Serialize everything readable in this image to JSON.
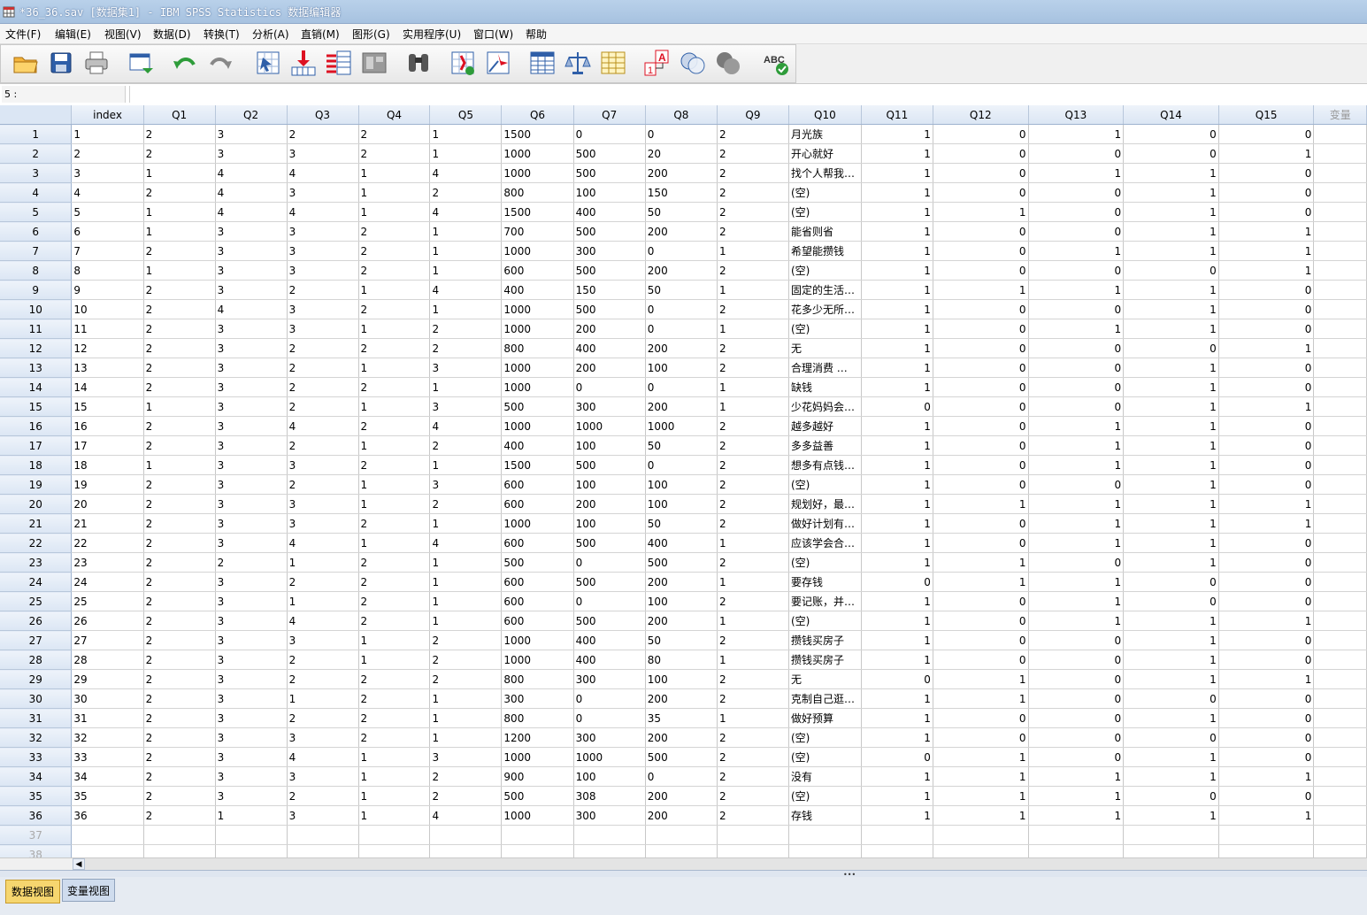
{
  "window": {
    "title": "*36_36.sav [数据集1] - IBM SPSS Statistics 数据编辑器"
  },
  "menu": [
    "文件(F)",
    "编辑(E)",
    "视图(V)",
    "数据(D)",
    "转换(T)",
    "分析(A)",
    "直销(M)",
    "图形(G)",
    "实用程序(U)",
    "窗口(W)",
    "帮助"
  ],
  "toolbar": {
    "icons": [
      "open-folder-icon",
      "save-icon",
      "print-icon",
      "recall-dialog-icon",
      "undo-icon",
      "redo-icon",
      "goto-case-icon",
      "goto-variable-icon",
      "variables-icon",
      "run-descriptives-icon",
      "find-icon",
      "insert-cases-icon",
      "insert-variable-icon",
      "split-file-icon",
      "weight-cases-icon",
      "select-cases-icon",
      "value-labels-icon",
      "use-sets-icon",
      "show-all-variables-icon",
      "spell-check-icon"
    ]
  },
  "cellbar": {
    "ref": "5 :",
    "value": ""
  },
  "columns": [
    "index",
    "Q1",
    "Q2",
    "Q3",
    "Q4",
    "Q5",
    "Q6",
    "Q7",
    "Q8",
    "Q9",
    "Q10",
    "Q11",
    "Q12",
    "Q13",
    "Q14",
    "Q15",
    "变量"
  ],
  "rows": [
    [
      "1",
      "2",
      "3",
      "2",
      "2",
      "1",
      "1500",
      "0",
      "0",
      "2",
      "月光族",
      "1",
      "0",
      "1",
      "0",
      "0"
    ],
    [
      "2",
      "2",
      "3",
      "3",
      "2",
      "1",
      "1000",
      "500",
      "20",
      "2",
      "开心就好",
      "1",
      "0",
      "0",
      "0",
      "1"
    ],
    [
      "3",
      "1",
      "4",
      "4",
      "1",
      "4",
      "1000",
      "500",
      "200",
      "2",
      "找个人帮我…",
      "1",
      "0",
      "1",
      "1",
      "0"
    ],
    [
      "4",
      "2",
      "4",
      "3",
      "1",
      "2",
      "800",
      "100",
      "150",
      "2",
      "(空)",
      "1",
      "0",
      "0",
      "1",
      "0"
    ],
    [
      "5",
      "1",
      "4",
      "4",
      "1",
      "4",
      "1500",
      "400",
      "50",
      "2",
      "(空)",
      "1",
      "1",
      "0",
      "1",
      "0"
    ],
    [
      "6",
      "1",
      "3",
      "3",
      "2",
      "1",
      "700",
      "500",
      "200",
      "2",
      "能省则省",
      "1",
      "0",
      "0",
      "1",
      "1"
    ],
    [
      "7",
      "2",
      "3",
      "3",
      "2",
      "1",
      "1000",
      "300",
      "0",
      "1",
      "希望能攒钱",
      "1",
      "0",
      "1",
      "1",
      "1"
    ],
    [
      "8",
      "1",
      "3",
      "3",
      "2",
      "1",
      "600",
      "500",
      "200",
      "2",
      "(空)",
      "1",
      "0",
      "0",
      "0",
      "1"
    ],
    [
      "9",
      "2",
      "3",
      "2",
      "1",
      "4",
      "400",
      "150",
      "50",
      "1",
      "固定的生活…",
      "1",
      "1",
      "1",
      "1",
      "0"
    ],
    [
      "10",
      "2",
      "4",
      "3",
      "2",
      "1",
      "1000",
      "500",
      "0",
      "2",
      "花多少无所…",
      "1",
      "0",
      "0",
      "1",
      "0"
    ],
    [
      "11",
      "2",
      "3",
      "3",
      "1",
      "2",
      "1000",
      "200",
      "0",
      "1",
      "(空)",
      "1",
      "0",
      "1",
      "1",
      "0"
    ],
    [
      "12",
      "2",
      "3",
      "2",
      "2",
      "2",
      "800",
      "400",
      "200",
      "2",
      "无",
      "1",
      "0",
      "0",
      "0",
      "1"
    ],
    [
      "13",
      "2",
      "3",
      "2",
      "1",
      "3",
      "1000",
      "200",
      "100",
      "2",
      "合理消费 …",
      "1",
      "0",
      "0",
      "1",
      "0"
    ],
    [
      "14",
      "2",
      "3",
      "2",
      "2",
      "1",
      "1000",
      "0",
      "0",
      "1",
      "缺钱",
      "1",
      "0",
      "0",
      "1",
      "0"
    ],
    [
      "15",
      "1",
      "3",
      "2",
      "1",
      "3",
      "500",
      "300",
      "200",
      "1",
      "少花妈妈会…",
      "0",
      "0",
      "0",
      "1",
      "1"
    ],
    [
      "16",
      "2",
      "3",
      "4",
      "2",
      "4",
      "1000",
      "1000",
      "1000",
      "2",
      "越多越好",
      "1",
      "0",
      "1",
      "1",
      "0"
    ],
    [
      "17",
      "2",
      "3",
      "2",
      "1",
      "2",
      "400",
      "100",
      "50",
      "2",
      "多多益善",
      "1",
      "0",
      "1",
      "1",
      "0"
    ],
    [
      "18",
      "1",
      "3",
      "3",
      "2",
      "1",
      "1500",
      "500",
      "0",
      "2",
      "想多有点钱…",
      "1",
      "0",
      "1",
      "1",
      "0"
    ],
    [
      "19",
      "2",
      "3",
      "2",
      "1",
      "3",
      "600",
      "100",
      "100",
      "2",
      "(空)",
      "1",
      "0",
      "0",
      "1",
      "0"
    ],
    [
      "20",
      "2",
      "3",
      "3",
      "1",
      "2",
      "600",
      "200",
      "100",
      "2",
      "规划好，最…",
      "1",
      "1",
      "1",
      "1",
      "1"
    ],
    [
      "21",
      "2",
      "3",
      "3",
      "2",
      "1",
      "1000",
      "100",
      "50",
      "2",
      "做好计划有…",
      "1",
      "0",
      "1",
      "1",
      "1"
    ],
    [
      "22",
      "2",
      "3",
      "4",
      "1",
      "4",
      "600",
      "500",
      "400",
      "1",
      "应该学会合…",
      "1",
      "0",
      "1",
      "1",
      "0"
    ],
    [
      "23",
      "2",
      "2",
      "1",
      "2",
      "1",
      "500",
      "0",
      "500",
      "2",
      "(空)",
      "1",
      "1",
      "0",
      "1",
      "0"
    ],
    [
      "24",
      "2",
      "3",
      "2",
      "2",
      "1",
      "600",
      "500",
      "200",
      "1",
      "要存钱",
      "0",
      "1",
      "1",
      "0",
      "0"
    ],
    [
      "25",
      "2",
      "3",
      "1",
      "2",
      "1",
      "600",
      "0",
      "100",
      "2",
      "要记账，并…",
      "1",
      "0",
      "1",
      "0",
      "0"
    ],
    [
      "26",
      "2",
      "3",
      "4",
      "2",
      "1",
      "600",
      "500",
      "200",
      "1",
      "(空)",
      "1",
      "0",
      "1",
      "1",
      "1"
    ],
    [
      "27",
      "2",
      "3",
      "3",
      "1",
      "2",
      "1000",
      "400",
      "50",
      "2",
      "攒钱买房子",
      "1",
      "0",
      "0",
      "1",
      "0"
    ],
    [
      "28",
      "2",
      "3",
      "2",
      "1",
      "2",
      "1000",
      "400",
      "80",
      "1",
      "攒钱买房子",
      "1",
      "0",
      "0",
      "1",
      "0"
    ],
    [
      "29",
      "2",
      "3",
      "2",
      "2",
      "2",
      "800",
      "300",
      "100",
      "2",
      "无",
      "0",
      "1",
      "0",
      "1",
      "1"
    ],
    [
      "30",
      "2",
      "3",
      "1",
      "2",
      "1",
      "300",
      "0",
      "200",
      "2",
      "克制自己逛…",
      "1",
      "1",
      "0",
      "0",
      "0"
    ],
    [
      "31",
      "2",
      "3",
      "2",
      "2",
      "1",
      "800",
      "0",
      "35",
      "1",
      "做好预算",
      "1",
      "0",
      "0",
      "1",
      "0"
    ],
    [
      "32",
      "2",
      "3",
      "3",
      "2",
      "1",
      "1200",
      "300",
      "200",
      "2",
      "(空)",
      "1",
      "0",
      "0",
      "0",
      "0"
    ],
    [
      "33",
      "2",
      "3",
      "4",
      "1",
      "3",
      "1000",
      "1000",
      "500",
      "2",
      "(空)",
      "0",
      "1",
      "0",
      "1",
      "0"
    ],
    [
      "34",
      "2",
      "3",
      "3",
      "1",
      "2",
      "900",
      "100",
      "0",
      "2",
      "没有",
      "1",
      "1",
      "1",
      "1",
      "1"
    ],
    [
      "35",
      "2",
      "3",
      "2",
      "1",
      "2",
      "500",
      "308",
      "200",
      "2",
      "(空)",
      "1",
      "1",
      "1",
      "0",
      "0"
    ],
    [
      "36",
      "2",
      "1",
      "3",
      "1",
      "4",
      "1000",
      "300",
      "200",
      "2",
      "存钱",
      "1",
      "1",
      "1",
      "1",
      "1"
    ]
  ],
  "empty_rows": [
    "37",
    "38"
  ],
  "tabs": {
    "data_view": "数据视图",
    "variable_view": "变量视图"
  }
}
